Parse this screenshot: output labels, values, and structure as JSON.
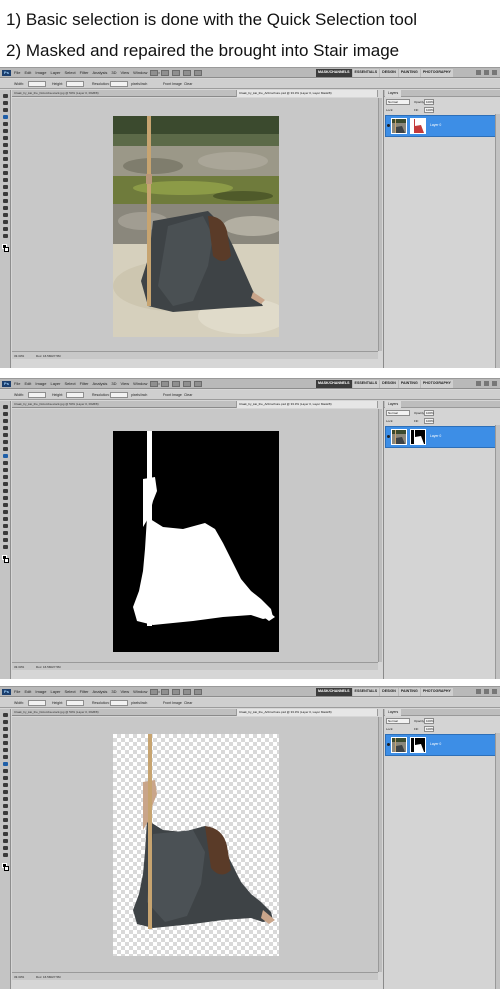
{
  "captions": {
    "step1": "1) Basic selection is done with the Quick Selection tool",
    "step2": "2) Masked and repaired the brought into Stair image"
  },
  "app": {
    "logo": "Ps",
    "menu": [
      "File",
      "Edit",
      "Image",
      "Layer",
      "Select",
      "Filter",
      "Analysis",
      "3D",
      "View",
      "Window",
      "Help"
    ],
    "workspaces": [
      "MASK/CHANNELS",
      "ESSENTIALS",
      "DESIGN",
      "PAINTING",
      "PHOTOGRAPHY"
    ],
    "active_workspace": "MASK/CHANNELS"
  },
  "options_bar": {
    "width_label": "Width:",
    "height_label": "Height:",
    "resolution_label": "Resolution:",
    "resolution_unit": "pixels/inch",
    "front_image": "Front Image",
    "clear": "Clear"
  },
  "document_tabs": [
    "Cloak_by_kai_the_Dolomba-stock.jpg @ 50% (Layer 0, RGB/8)",
    "Cloak_by_kai_the_Artbrochure.psd @ 33.3% (Layer 0, Layer Mask/8)"
  ],
  "screens": [
    {
      "status_zoom": "33.33%",
      "status_doc": "Doc: 16.5M/27.5M"
    },
    {
      "status_zoom": "33.33%",
      "status_doc": "Doc: 16.5M/27.5M"
    },
    {
      "status_zoom": "33.33%",
      "status_doc": "Doc: 16.5M/27.5M"
    }
  ],
  "layers_panel": {
    "tab": "Layers",
    "blend_mode": "Normal",
    "opacity_label": "Opacity:",
    "opacity_value": "100%",
    "lock_label": "Lock:",
    "fill_label": "Fill:",
    "fill_value": "100%",
    "layer_name": "Layer 0"
  },
  "colors": {
    "panel_bg": "#d6d6d6",
    "canvas_bg": "#c8c8c8",
    "selected_layer": "#3d8ee6",
    "mask_black": "#000000",
    "mask_white": "#ffffff"
  }
}
